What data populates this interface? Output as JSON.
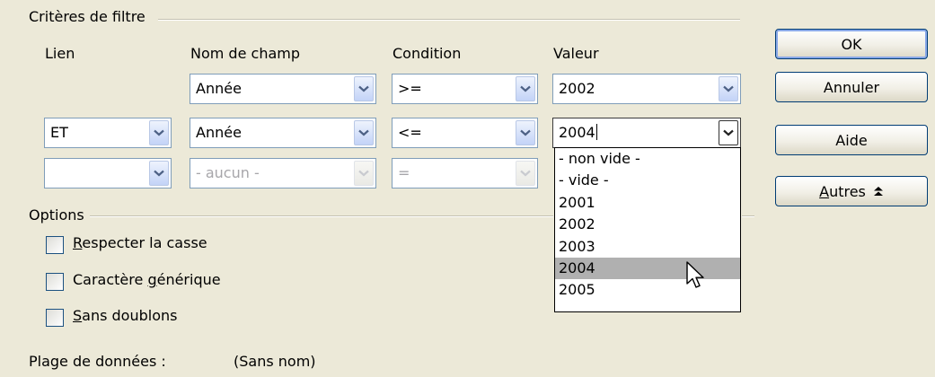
{
  "criteria": {
    "title": "Critères de filtre",
    "headers": {
      "link": "Lien",
      "field": "Nom de champ",
      "condition": "Condition",
      "value": "Valeur"
    },
    "rows": [
      {
        "link": "",
        "field": "Année",
        "condition": ">=",
        "value": "2002"
      },
      {
        "link": "ET",
        "field": "Année",
        "condition": "<=",
        "value": "2004"
      },
      {
        "link": "",
        "field": "- aucun -",
        "condition": "=",
        "value": ""
      }
    ]
  },
  "value_dropdown": {
    "options": [
      "- non vide -",
      "- vide -",
      "2001",
      "2002",
      "2003",
      "2004",
      "2005"
    ],
    "highlighted": "2004"
  },
  "options": {
    "title": "Options",
    "case_prefix": "",
    "case_accel": "R",
    "case_rest": "especter la casse",
    "wild_prefix": "Caractère ",
    "wild_accel": "g",
    "wild_rest": "énérique",
    "dup_prefix": "",
    "dup_accel": "S",
    "dup_rest": "ans doublons"
  },
  "data_range": {
    "label": "Plage de données :",
    "value": "(Sans nom)"
  },
  "buttons": {
    "ok": "OK",
    "cancel": "Annuler",
    "help": "Aide",
    "more_accel": "A",
    "more_rest": "utres",
    "more_icon": "double-chevron-up-icon"
  },
  "colors": {
    "dialog_bg": "#ece9d8",
    "combo_border": "#7f9db9",
    "highlight": "#b0b0b0"
  }
}
